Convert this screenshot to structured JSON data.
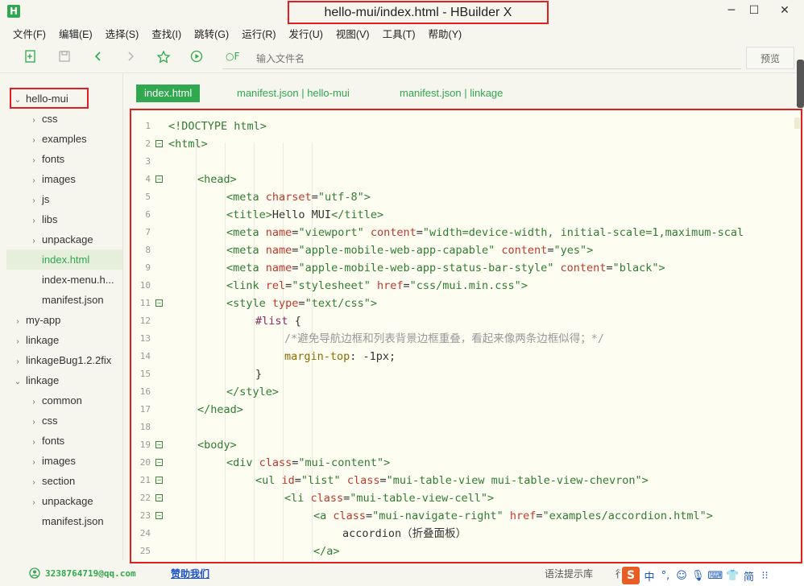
{
  "app": {
    "logo": "H",
    "title": "hello-mui/index.html - HBuilder X"
  },
  "window_controls": {
    "minimize": "─",
    "maximize": "☐",
    "close": "✕"
  },
  "menu": [
    "文件(F)",
    "编辑(E)",
    "选择(S)",
    "查找(I)",
    "跳转(G)",
    "运行(R)",
    "发行(U)",
    "视图(V)",
    "工具(T)",
    "帮助(Y)"
  ],
  "toolbar": {
    "search_icon_label": "○F",
    "search_placeholder": "输入文件名",
    "preview_label": "预览"
  },
  "sidebar": {
    "items": [
      {
        "label": "hello-mui",
        "arrow": "⌄",
        "level": 0
      },
      {
        "label": "css",
        "arrow": "›",
        "level": 1
      },
      {
        "label": "examples",
        "arrow": "›",
        "level": 1
      },
      {
        "label": "fonts",
        "arrow": "›",
        "level": 1
      },
      {
        "label": "images",
        "arrow": "›",
        "level": 1
      },
      {
        "label": "js",
        "arrow": "›",
        "level": 1
      },
      {
        "label": "libs",
        "arrow": "›",
        "level": 1
      },
      {
        "label": "unpackage",
        "arrow": "›",
        "level": 1
      },
      {
        "label": "index.html",
        "arrow": "",
        "level": 1,
        "selected": true
      },
      {
        "label": "index-menu.h...",
        "arrow": "",
        "level": 1
      },
      {
        "label": "manifest.json",
        "arrow": "",
        "level": 1
      },
      {
        "label": "my-app",
        "arrow": "›",
        "level": 0
      },
      {
        "label": "linkage",
        "arrow": "›",
        "level": 0
      },
      {
        "label": "linkageBug1.2.2fix",
        "arrow": "›",
        "level": 0
      },
      {
        "label": "linkage",
        "arrow": "⌄",
        "level": 0
      },
      {
        "label": "common",
        "arrow": "›",
        "level": 1
      },
      {
        "label": "css",
        "arrow": "›",
        "level": 1
      },
      {
        "label": "fonts",
        "arrow": "›",
        "level": 1
      },
      {
        "label": "images",
        "arrow": "›",
        "level": 1
      },
      {
        "label": "section",
        "arrow": "›",
        "level": 1
      },
      {
        "label": "unpackage",
        "arrow": "›",
        "level": 1
      },
      {
        "label": "manifest.json",
        "arrow": "",
        "level": 1
      }
    ]
  },
  "tabs": [
    {
      "label": "index.html",
      "active": true
    },
    {
      "label": "manifest.json | hello-mui",
      "active": false
    },
    {
      "label": "manifest.json | linkage",
      "active": false
    }
  ],
  "editor": {
    "lines": [
      {
        "n": "1",
        "fold": "",
        "indent": 0,
        "parts": [
          [
            "tag",
            "<!DOCTYPE html>"
          ]
        ]
      },
      {
        "n": "2",
        "fold": "−",
        "indent": 0,
        "parts": [
          [
            "tag",
            "<html>"
          ]
        ]
      },
      {
        "n": "3",
        "fold": "",
        "indent": 0,
        "parts": []
      },
      {
        "n": "4",
        "fold": "−",
        "indent": 1,
        "parts": [
          [
            "tag",
            "<head>"
          ]
        ]
      },
      {
        "n": "5",
        "fold": "",
        "indent": 2,
        "parts": [
          [
            "tag",
            "<meta "
          ],
          [
            "attr",
            "charset"
          ],
          [
            "txt",
            "="
          ],
          [
            "str",
            "\"utf-8\""
          ],
          [
            "tag",
            ">"
          ]
        ]
      },
      {
        "n": "6",
        "fold": "",
        "indent": 2,
        "parts": [
          [
            "tag",
            "<title>"
          ],
          [
            "txt",
            "Hello MUI"
          ],
          [
            "tag",
            "</title>"
          ]
        ]
      },
      {
        "n": "7",
        "fold": "",
        "indent": 2,
        "parts": [
          [
            "tag",
            "<meta "
          ],
          [
            "attr",
            "name"
          ],
          [
            "txt",
            "="
          ],
          [
            "str",
            "\"viewport\" "
          ],
          [
            "attr",
            "content"
          ],
          [
            "txt",
            "="
          ],
          [
            "str",
            "\"width=device-width, initial-scale=1,maximum-scal"
          ]
        ]
      },
      {
        "n": "8",
        "fold": "",
        "indent": 2,
        "parts": [
          [
            "tag",
            "<meta "
          ],
          [
            "attr",
            "name"
          ],
          [
            "txt",
            "="
          ],
          [
            "str",
            "\"apple-mobile-web-app-capable\" "
          ],
          [
            "attr",
            "content"
          ],
          [
            "txt",
            "="
          ],
          [
            "str",
            "\"yes\""
          ],
          [
            "tag",
            ">"
          ]
        ]
      },
      {
        "n": "9",
        "fold": "",
        "indent": 2,
        "parts": [
          [
            "tag",
            "<meta "
          ],
          [
            "attr",
            "name"
          ],
          [
            "txt",
            "="
          ],
          [
            "str",
            "\"apple-mobile-web-app-status-bar-style\" "
          ],
          [
            "attr",
            "content"
          ],
          [
            "txt",
            "="
          ],
          [
            "str",
            "\"black\""
          ],
          [
            "tag",
            ">"
          ]
        ]
      },
      {
        "n": "10",
        "fold": "",
        "indent": 2,
        "parts": [
          [
            "tag",
            "<link "
          ],
          [
            "attr",
            "rel"
          ],
          [
            "txt",
            "="
          ],
          [
            "str",
            "\"stylesheet\" "
          ],
          [
            "attr",
            "href"
          ],
          [
            "txt",
            "="
          ],
          [
            "str",
            "\"css/mui.min.css\""
          ],
          [
            "tag",
            ">"
          ]
        ]
      },
      {
        "n": "11",
        "fold": "−",
        "indent": 2,
        "parts": [
          [
            "tag",
            "<style "
          ],
          [
            "attr",
            "type"
          ],
          [
            "txt",
            "="
          ],
          [
            "str",
            "\"text/css\""
          ],
          [
            "tag",
            ">"
          ]
        ]
      },
      {
        "n": "12",
        "fold": "",
        "indent": 3,
        "parts": [
          [
            "sel",
            "#list"
          ],
          [
            "txt",
            " {"
          ]
        ]
      },
      {
        "n": "13",
        "fold": "",
        "indent": 4,
        "parts": [
          [
            "cmt",
            "/*避免导航边框和列表背景边框重叠，看起来像两条边框似得；*/"
          ]
        ]
      },
      {
        "n": "14",
        "fold": "",
        "indent": 4,
        "parts": [
          [
            "prop",
            "margin-top"
          ],
          [
            "txt",
            ": -1px;"
          ]
        ]
      },
      {
        "n": "15",
        "fold": "",
        "indent": 3,
        "parts": [
          [
            "txt",
            "}"
          ]
        ]
      },
      {
        "n": "16",
        "fold": "",
        "indent": 2,
        "parts": [
          [
            "tag",
            "</style>"
          ]
        ]
      },
      {
        "n": "17",
        "fold": "",
        "indent": 1,
        "parts": [
          [
            "tag",
            "</head>"
          ]
        ]
      },
      {
        "n": "18",
        "fold": "",
        "indent": 0,
        "parts": []
      },
      {
        "n": "19",
        "fold": "−",
        "indent": 1,
        "parts": [
          [
            "tag",
            "<body>"
          ]
        ]
      },
      {
        "n": "20",
        "fold": "−",
        "indent": 2,
        "parts": [
          [
            "tag",
            "<div "
          ],
          [
            "attr",
            "class"
          ],
          [
            "txt",
            "="
          ],
          [
            "str",
            "\"mui-content\""
          ],
          [
            "tag",
            ">"
          ]
        ]
      },
      {
        "n": "21",
        "fold": "−",
        "indent": 3,
        "parts": [
          [
            "tag",
            "<ul "
          ],
          [
            "attr",
            "id"
          ],
          [
            "txt",
            "="
          ],
          [
            "str",
            "\"list\" "
          ],
          [
            "attr",
            "class"
          ],
          [
            "txt",
            "="
          ],
          [
            "str",
            "\"mui-table-view mui-table-view-chevron\""
          ],
          [
            "tag",
            ">"
          ]
        ]
      },
      {
        "n": "22",
        "fold": "−",
        "indent": 4,
        "parts": [
          [
            "tag",
            "<li "
          ],
          [
            "attr",
            "class"
          ],
          [
            "txt",
            "="
          ],
          [
            "str",
            "\"mui-table-view-cell\""
          ],
          [
            "tag",
            ">"
          ]
        ]
      },
      {
        "n": "23",
        "fold": "−",
        "indent": 5,
        "parts": [
          [
            "tag",
            "<a "
          ],
          [
            "attr",
            "class"
          ],
          [
            "txt",
            "="
          ],
          [
            "str",
            "\"mui-navigate-right\" "
          ],
          [
            "attr",
            "href"
          ],
          [
            "txt",
            "="
          ],
          [
            "str",
            "\"examples/accordion.html\""
          ],
          [
            "tag",
            ">"
          ]
        ]
      },
      {
        "n": "24",
        "fold": "",
        "indent": 6,
        "parts": [
          [
            "txt",
            "accordion（折叠面板）"
          ]
        ]
      },
      {
        "n": "25",
        "fold": "",
        "indent": 5,
        "parts": [
          [
            "tag",
            "</a>"
          ]
        ]
      }
    ]
  },
  "status": {
    "qq": "3238764719@qq.com",
    "sponsor": "赞助我们",
    "syntax_hint": "语法提示库",
    "row_label": "行",
    "ime": [
      "S",
      "中",
      "°,",
      "☺",
      "🎙",
      "⌨",
      "👕",
      "简",
      "⁝⁝"
    ]
  }
}
